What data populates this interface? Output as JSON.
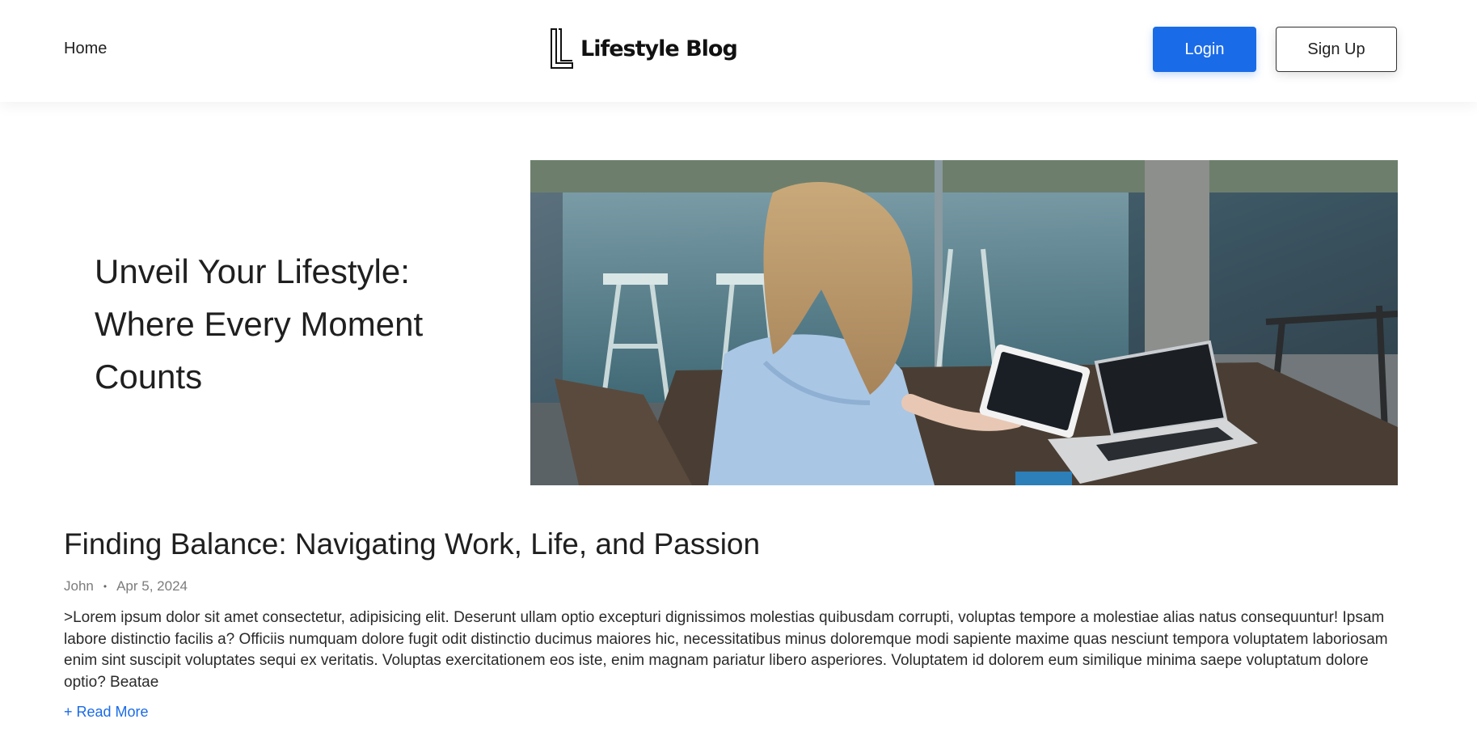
{
  "header": {
    "home_label": "Home",
    "brand_name": "Lifestyle Blog",
    "login_label": "Login",
    "signup_label": "Sign Up"
  },
  "hero": {
    "title_line1": "Unveil Your Lifestyle:",
    "title_line2": "Where Every Moment",
    "title_line3": "Counts",
    "image_alt": "Woman in a blue shirt using a tablet next to a laptop at an outdoor table"
  },
  "article": {
    "title": "Finding Balance: Navigating Work, Life, and Passion",
    "author": "John",
    "separator": "•",
    "date": "Apr 5, 2024",
    "excerpt": ">Lorem ipsum dolor sit amet consectetur, adipisicing elit. Deserunt ullam optio excepturi dignissimos molestias quibusdam corrupti, voluptas tempore a molestiae alias natus consequuntur! Ipsam labore distinctio facilis a? Officiis numquam dolore fugit odit distinctio ducimus maiores hic, necessitatibus minus doloremque modi sapiente maxime quas nesciunt tempora voluptatem laboriosam enim sint suscipit voluptates sequi ex veritatis. Voluptas exercitationem eos iste, enim magnam pariatur libero asperiores. Voluptatem id dolorem eum similique minima saepe voluptatum dolore optio? Beatae",
    "read_more_label": "+ Read More"
  },
  "colors": {
    "accent": "#1a6be8",
    "text": "#1f1f1f",
    "muted": "#7c7c7c"
  }
}
